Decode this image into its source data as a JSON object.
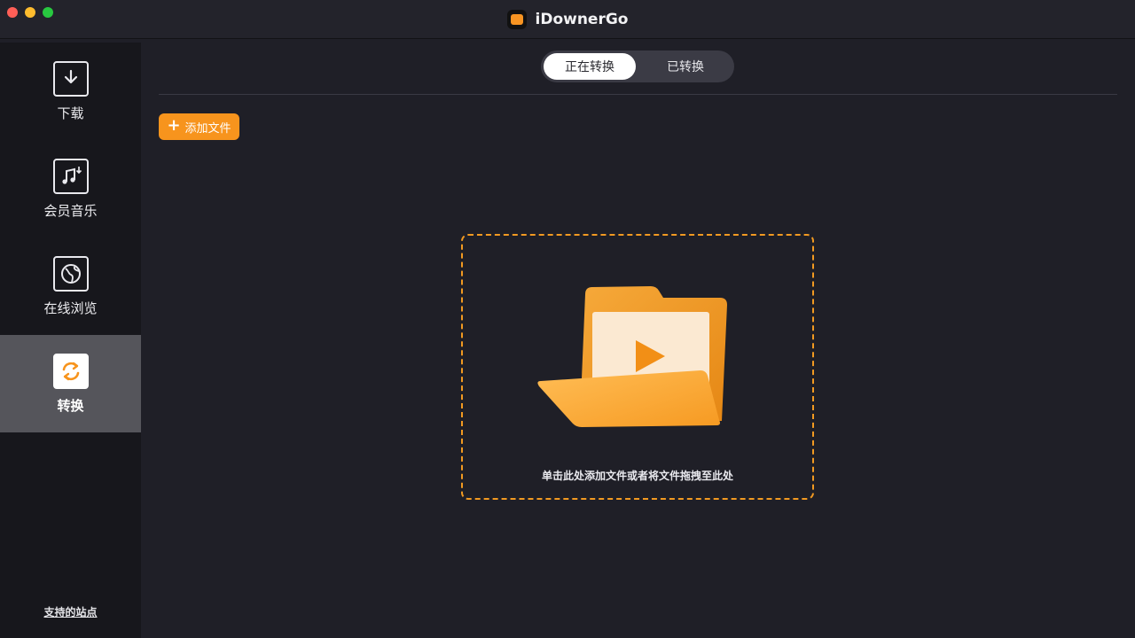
{
  "window": {
    "title": "iDownerGo"
  },
  "sidebar": {
    "items": [
      {
        "label": "下载",
        "icon": "download-icon"
      },
      {
        "label": "会员音乐",
        "icon": "music-icon"
      },
      {
        "label": "在线浏览",
        "icon": "browser-globe-icon"
      },
      {
        "label": "转换",
        "icon": "convert-icon",
        "active": true
      }
    ],
    "supported_sites": "支持的站点"
  },
  "main": {
    "tabs": [
      {
        "label": "正在转换",
        "active": true
      },
      {
        "label": "已转换",
        "active": false
      }
    ],
    "add_file_label": "添加文件",
    "dropzone_text": "单击此处添加文件或者将文件拖拽至此处"
  },
  "colors": {
    "accent": "#f7941d",
    "background": "#1f1f27",
    "sidebar": "#17171c",
    "active_item": "#55555b"
  }
}
